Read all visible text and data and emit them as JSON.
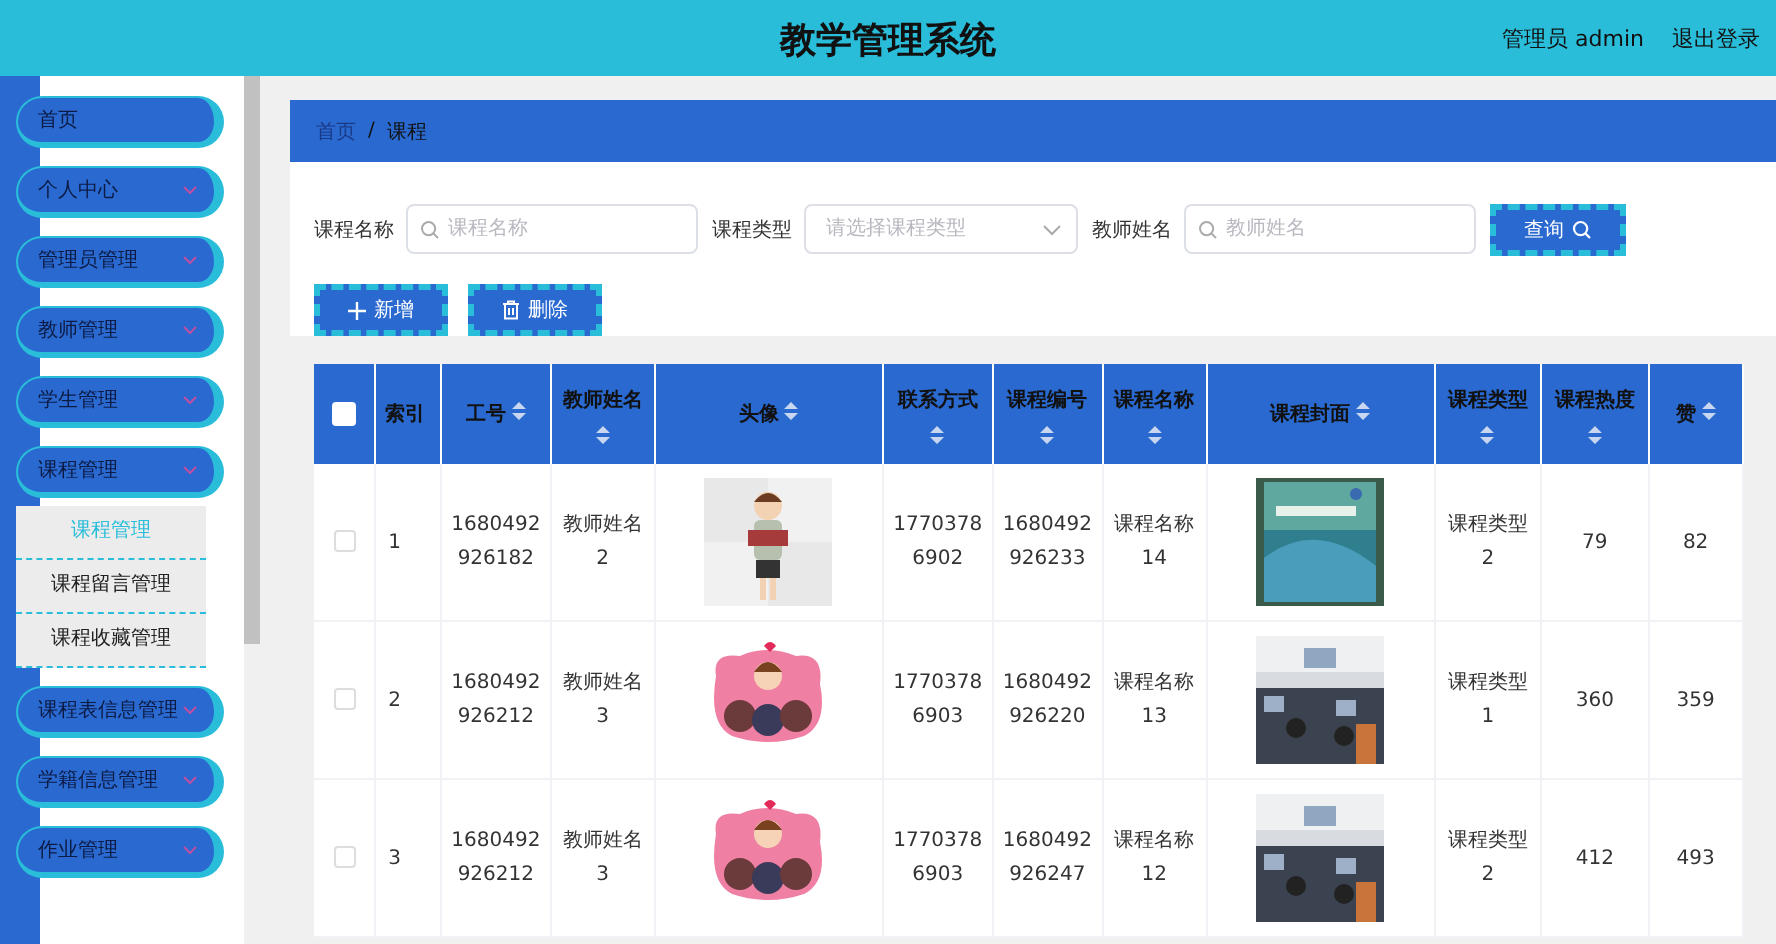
{
  "header": {
    "title": "教学管理系统",
    "user": "管理员 admin",
    "logout": "退出登录"
  },
  "sidebar": {
    "items": [
      {
        "label": "首页",
        "has_children": false
      },
      {
        "label": "个人中心",
        "has_children": true
      },
      {
        "label": "管理员管理",
        "has_children": true
      },
      {
        "label": "教师管理",
        "has_children": true
      },
      {
        "label": "学生管理",
        "has_children": true
      },
      {
        "label": "课程管理",
        "has_children": true,
        "children": [
          {
            "label": "课程管理",
            "selected": true
          },
          {
            "label": "课程留言管理",
            "selected": false
          },
          {
            "label": "课程收藏管理",
            "selected": false
          }
        ]
      },
      {
        "label": "课程表信息管理",
        "has_children": true
      },
      {
        "label": "学籍信息管理",
        "has_children": true
      },
      {
        "label": "作业管理",
        "has_children": true
      }
    ]
  },
  "breadcrumb": {
    "items": [
      "首页",
      "课程"
    ],
    "separator": "/"
  },
  "search": {
    "fields": [
      {
        "label": "课程名称",
        "kind": "input",
        "placeholder": "课程名称"
      },
      {
        "label": "课程类型",
        "kind": "select",
        "placeholder": "请选择课程类型"
      },
      {
        "label": "教师姓名",
        "kind": "input",
        "placeholder": "教师姓名"
      }
    ],
    "button": "查询"
  },
  "actions": [
    {
      "label": "新增",
      "kind": "add"
    },
    {
      "label": "删除",
      "kind": "delete"
    }
  ],
  "table": {
    "all_selected": false,
    "columns": [
      {
        "label": "索引",
        "sortable": false
      },
      {
        "label": "工号",
        "sortable": true
      },
      {
        "label": "教师姓名",
        "sortable": true
      },
      {
        "label": "头像",
        "sortable": true
      },
      {
        "label": "联系方式",
        "sortable": true
      },
      {
        "label": "课程编号",
        "sortable": true
      },
      {
        "label": "课程名称",
        "sortable": true
      },
      {
        "label": "课程封面",
        "sortable": true
      },
      {
        "label": "课程类型",
        "sortable": true
      },
      {
        "label": "课程热度",
        "sortable": true
      },
      {
        "label": "赞",
        "sortable": true
      }
    ],
    "rows": [
      {
        "selected": false,
        "index": "1",
        "staff_no": "1680492\n926182",
        "teacher": "教师姓名\n2",
        "phone": "17703786902",
        "course_no": "1680492\n926233",
        "course_name": "课程名称\n14",
        "course_type": "课程类型\n2",
        "heat": "79",
        "likes": "82"
      },
      {
        "selected": false,
        "index": "2",
        "staff_no": "1680492\n926212",
        "teacher": "教师姓名\n3",
        "phone": "17703786903",
        "course_no": "1680492\n926220",
        "course_name": "课程名称\n13",
        "course_type": "课程类型\n1",
        "heat": "360",
        "likes": "359"
      },
      {
        "selected": false,
        "index": "3",
        "staff_no": "1680492\n926212",
        "teacher": "教师姓名\n3",
        "phone": "17703786903",
        "course_no": "1680492\n926247",
        "course_name": "课程名称\n12",
        "course_type": "课程类型\n2",
        "heat": "412",
        "likes": "493"
      }
    ]
  }
}
